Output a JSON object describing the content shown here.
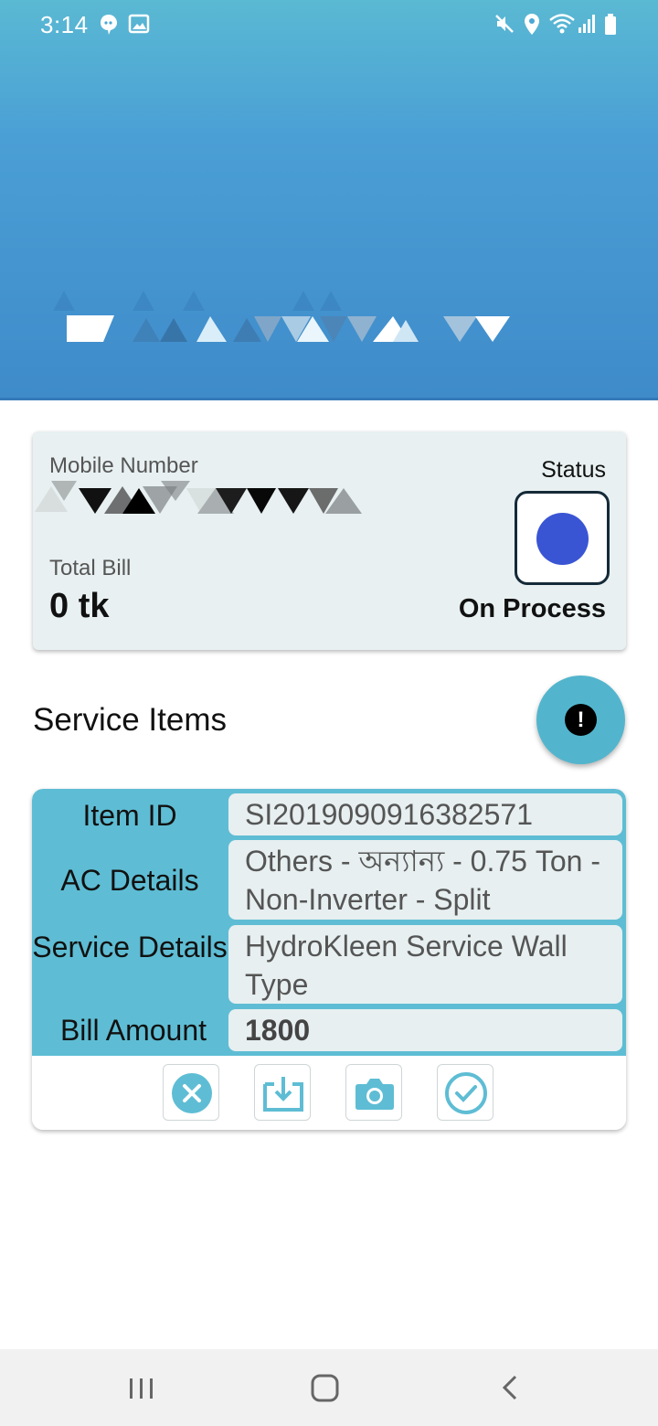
{
  "status_bar": {
    "time": "3:14",
    "left_icons": [
      "chat-bubble-icon",
      "image-icon"
    ],
    "right_icons": [
      "mute-icon",
      "location-icon",
      "wifi-icon",
      "signal-icon",
      "battery-icon"
    ]
  },
  "colors": {
    "header_top": "#5ab9d3",
    "header_bottom": "#3f8bca",
    "accent": "#5ebdd4",
    "status_dot": "#3a55d3"
  },
  "summary": {
    "mobile_label": "Mobile Number",
    "total_label": "Total Bill",
    "total_value": "0 tk",
    "status_label": "Status",
    "status_text": "On Process"
  },
  "section": {
    "title": "Service Items"
  },
  "fab_icon": "exclamation-icon",
  "item": {
    "rows": [
      {
        "label": "Item ID",
        "value": "SI2019090916382571"
      },
      {
        "label": "AC Details",
        "value": "Others - অন্যান্য - 0.75 Ton - Non-Inverter - Split"
      },
      {
        "label": "Service Details",
        "value": "HydroKleen Service Wall Type"
      },
      {
        "label": "Bill Amount",
        "value": "1800"
      }
    ],
    "actions": [
      "cancel-icon",
      "download-icon",
      "camera-icon",
      "check-icon"
    ]
  },
  "nav": [
    "recent-apps-icon",
    "home-icon",
    "back-icon"
  ]
}
